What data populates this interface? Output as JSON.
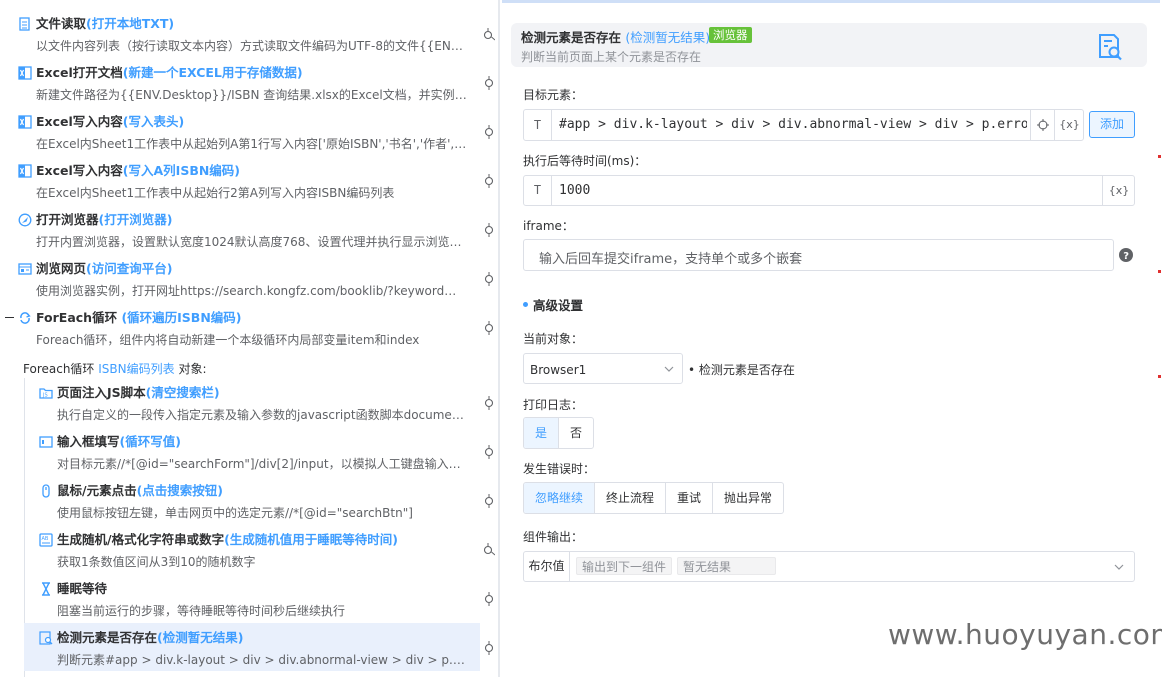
{
  "flow": {
    "steps": [
      {
        "title": "文件读取",
        "alias": "(打开本地TXT)",
        "desc": "以文件内容列表（按行读取文本内容）方式读取文件编码为UTF-8的文件{{ENV.Desktop}}/...",
        "icon": "file-read-icon"
      },
      {
        "title": "Excel打开文档",
        "alias": "(新建一个EXCEL用于存储数据)",
        "desc": "新建文件路径为{{ENV.Desktop}}/ISBN 查询结果.xlsx的Excel文档，并实例化初始化...",
        "icon": "excel-icon"
      },
      {
        "title": "Excel写入内容",
        "alias": "(写入表头)",
        "desc": "在Excel内Sheet1工作表中从起始列A第1行写入内容['原始ISBN','书名','作者','出版社'...",
        "icon": "excel-icon"
      },
      {
        "title": "Excel写入内容",
        "alias": "(写入A列ISBN编码)",
        "desc": "在Excel内Sheet1工作表中从起始行2第A列写入内容ISBN编码列表",
        "icon": "excel-icon"
      },
      {
        "title": "打开浏览器",
        "alias": "(打开浏览器)",
        "desc": "打开内置浏览器，设置默认宽度1024默认高度768、设置代理并执行显示浏览器...",
        "icon": "browser-icon"
      },
      {
        "title": "浏览网页",
        "alias": "(访问查询平台)",
        "desc": "使用浏览器实例，打开网址https://search.kongfz.com/booklib/?keyword并设置U...",
        "icon": "webpage-icon"
      },
      {
        "title": "ForEach循环",
        "alias": "(循环遍历ISBN编码)",
        "desc": "Foreach循环，组件内将自动新建一个本级循环内局部变量item和index",
        "icon": "loop-icon"
      }
    ],
    "foreach_label": {
      "prefix": "Foreach循环 ",
      "var": "ISBN编码列表",
      "suffix": " 对象:"
    },
    "inner_steps": [
      {
        "title": "页面注入JS脚本",
        "alias": "(清空搜索栏)",
        "desc": "执行自定义的一段传入指定元素及输入参数的javascript函数脚本document.g...",
        "icon": "folder-js-icon"
      },
      {
        "title": "输入框填写",
        "alias": "(循环写值)",
        "desc": "对目标元素//*[@id=\"searchForm\"]/div[2]/input，以模拟人工键盘输入方式写...",
        "icon": "input-box-icon"
      },
      {
        "title": "鼠标/元素点击",
        "alias": "(点击搜索按钮)",
        "desc": "使用鼠标按钮左键，单击网页中的选定元素//*[@id=\"searchBtn\"]",
        "icon": "mouse-icon"
      },
      {
        "title": "生成随机/格式化字符串或数字",
        "alias": "(生成随机值用于睡眠等待时间)",
        "desc": "获取1条数值区间从3到10的随机数字",
        "icon": "random-icon"
      },
      {
        "title": "睡眠等待",
        "alias": "",
        "desc": "阻塞当前运行的步骤，等待睡眠等待时间秒后继续执行",
        "icon": "hourglass-icon"
      },
      {
        "title": "检测元素是否存在",
        "alias": "(检测暂无结果)",
        "desc": "判断元素#app > div.k-layout > div > div.abnormal-view > div > p.error-title是...",
        "icon": "detect-element-icon"
      }
    ]
  },
  "panel": {
    "title": "检测元素是否存在",
    "alias": "(检测暂无结果)",
    "tag": "浏览器",
    "desc": "判断当前页面上某个元素是否存在",
    "target_label": "目标元素：",
    "target_type": "T",
    "target_value": "#app > div.k-layout > div > div.abnormal-view > div > p.error-title",
    "var_btn": "{x}",
    "add_btn": "添加",
    "wait_label": "执行后等待时间(ms)：",
    "wait_type": "T",
    "wait_value": "1000",
    "iframe_label": "iframe：",
    "iframe_placeholder": "输入后回车提交iframe，支持单个或多个嵌套",
    "advanced": "高级设置",
    "current_obj_label": "当前对象：",
    "current_obj_value": "Browser1",
    "current_obj_note": "• 检测元素是否存在",
    "log_label": "打印日志：",
    "log_options": [
      "是",
      "否"
    ],
    "log_selected": "是",
    "error_label": "发生错误时：",
    "error_options": [
      "忽略继续",
      "终止流程",
      "重试",
      "抛出异常"
    ],
    "error_selected": "忽略继续",
    "output_label": "组件输出：",
    "output_type": "布尔值",
    "output_chips": [
      "输出到下一组件",
      "暂无结果"
    ]
  },
  "watermark": "www.huoyuyan.com",
  "colors": {
    "accent": "#409eff",
    "tag_green": "#67c23a",
    "selected_bg": "#e9f0fc"
  }
}
